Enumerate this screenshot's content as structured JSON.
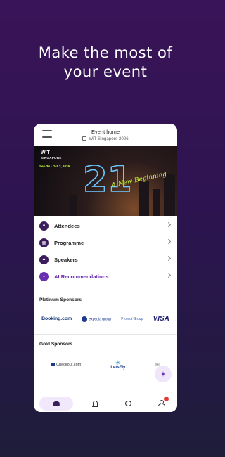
{
  "headline": [
    "Make the most of",
    "your event"
  ],
  "topbar": {
    "title": "Event home",
    "subtitle": "WiT Singapore 2026"
  },
  "banner": {
    "logo_top": "WiT",
    "logo_bottom": "SINGAPORE",
    "dates": "Sep 30 - Oct 2, 2026",
    "big_number": "21",
    "script_text": "A New Beginning",
    "accent_color": "#c8ff3a"
  },
  "menu": [
    {
      "label": "Attendees",
      "icon": "people-icon"
    },
    {
      "label": "Programme",
      "icon": "calendar-icon"
    },
    {
      "label": "Speakers",
      "icon": "speaker-icon"
    },
    {
      "label": "AI Recommendations",
      "icon": "sparkle-icon"
    }
  ],
  "platinum": {
    "title": "Platinum Sponsors",
    "sponsors": [
      "Booking.com",
      "expedia group",
      "Protect Group",
      "VISA"
    ]
  },
  "gold": {
    "title": "Gold Sponsors",
    "sponsors": [
      "Checkout.com",
      "LetsFly",
      "xe"
    ]
  },
  "bottom_nav": [
    "home-icon",
    "bell-icon",
    "chat-icon",
    "profile-icon"
  ],
  "colors": {
    "brand": "#3b1c5c",
    "accent": "#6a2fb0",
    "notification": "#e53935"
  }
}
